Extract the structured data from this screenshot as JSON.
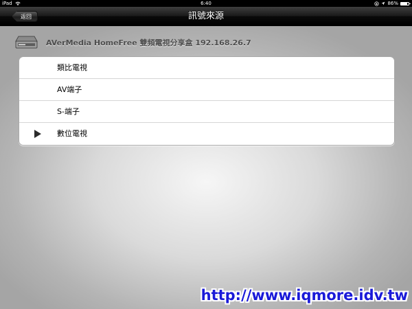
{
  "status_bar": {
    "device": "iPad",
    "time": "6:40",
    "battery": "86%",
    "battery_level": 0.86
  },
  "nav": {
    "back_label": "返回",
    "title": "訊號來源"
  },
  "header": {
    "device_name": "AVerMedia HomeFree 雙頻電視分享盒 192.168.26.7",
    "icon": "tv-box-icon"
  },
  "sources": {
    "items": [
      {
        "label": "類比電視",
        "selected": false
      },
      {
        "label": "AV端子",
        "selected": false
      },
      {
        "label": "S-端子",
        "selected": false
      },
      {
        "label": "數位電視",
        "selected": true
      }
    ]
  },
  "watermark": "http://www.iqmore.idv.tw"
}
